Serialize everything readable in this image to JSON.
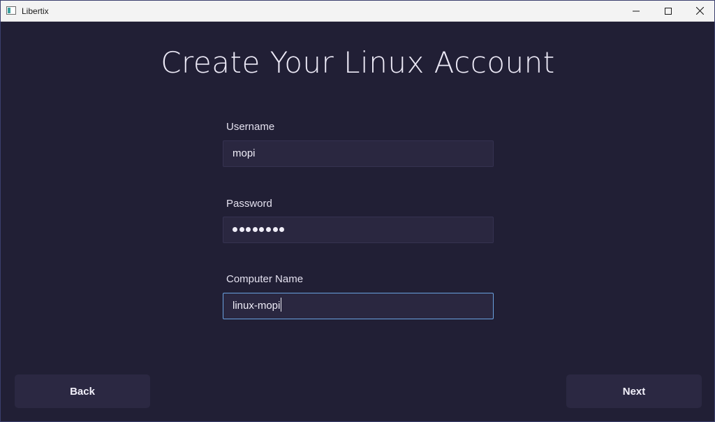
{
  "window": {
    "title": "Libertix"
  },
  "page": {
    "title": "Create Your Linux Account"
  },
  "form": {
    "username": {
      "label": "Username",
      "value": "mopi"
    },
    "password": {
      "label": "Password",
      "masked_length": 8
    },
    "computer_name": {
      "label": "Computer Name",
      "value": "linux-mopi"
    }
  },
  "buttons": {
    "back": "Back",
    "next": "Next"
  },
  "icons": {
    "app": "app-icon",
    "minimize": "minimize-icon",
    "maximize": "maximize-icon",
    "close": "close-icon"
  },
  "colors": {
    "background": "#211f35",
    "field_background": "#2a2740",
    "focus_border": "#6aa2e0",
    "button_background": "#2b2842"
  }
}
